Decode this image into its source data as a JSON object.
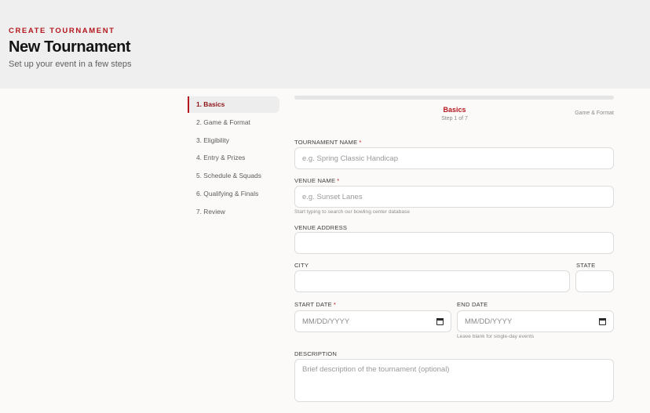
{
  "header": {
    "eyebrow": "CREATE TOURNAMENT",
    "title": "New Tournament",
    "subtitle": "Set up your event in a few steps"
  },
  "steps": [
    {
      "label": "1. Basics",
      "active": true
    },
    {
      "label": "2. Game & Format",
      "active": false
    },
    {
      "label": "3. Eligibility",
      "active": false
    },
    {
      "label": "4. Entry & Prizes",
      "active": false
    },
    {
      "label": "5. Schedule & Squads",
      "active": false
    },
    {
      "label": "6. Qualifying & Finals",
      "active": false
    },
    {
      "label": "7. Review",
      "active": false
    }
  ],
  "progress": {
    "current_label": "Basics",
    "count_text": "Step 1 of 7",
    "next_label": "Game & Format"
  },
  "form": {
    "tournament_name": {
      "label": "TOURNAMENT NAME",
      "required": "*",
      "placeholder": "e.g. Spring Classic Handicap",
      "value": ""
    },
    "venue_name": {
      "label": "VENUE NAME",
      "required": "*",
      "placeholder": "e.g. Sunset Lanes",
      "value": "",
      "hint": "Start typing to search our bowling center database"
    },
    "venue_address": {
      "label": "VENUE ADDRESS",
      "placeholder": "",
      "value": ""
    },
    "city": {
      "label": "CITY",
      "placeholder": "",
      "value": ""
    },
    "state": {
      "label": "STATE",
      "placeholder": "",
      "value": ""
    },
    "start_date": {
      "label": "START DATE",
      "required": "*",
      "placeholder": "MM/DD/YYYY"
    },
    "end_date": {
      "label": "END DATE",
      "placeholder": "MM/DD/YYYY",
      "hint": "Leave blank for single-day events"
    },
    "description": {
      "label": "DESCRIPTION",
      "placeholder": "Brief description of the tournament (optional)"
    }
  },
  "icons": {
    "date_picker": "calendar-icon"
  },
  "colors": {
    "accent": "#b4171d",
    "header_bg": "#efefef",
    "page_bg": "#fbfaf8"
  }
}
